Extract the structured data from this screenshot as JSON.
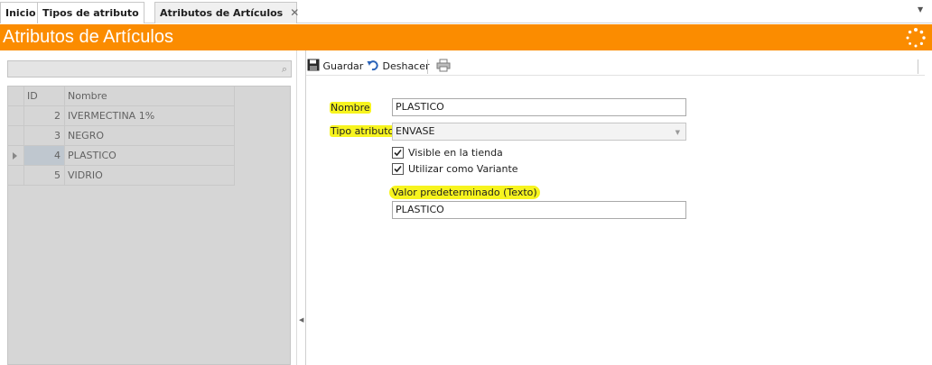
{
  "tabs": [
    {
      "label": "Inicio"
    },
    {
      "label": "Tipos de atributo"
    },
    {
      "label": "Atributos de Artículos",
      "close": "✕"
    }
  ],
  "window": {
    "title": "Atributos de Artículos"
  },
  "search": {
    "placeholder": ""
  },
  "grid": {
    "columns": [
      "ID",
      "Nombre"
    ],
    "rows": [
      {
        "id": "2",
        "nombre": "IVERMECTINA 1%"
      },
      {
        "id": "3",
        "nombre": "NEGRO"
      },
      {
        "id": "4",
        "nombre": "PLASTICO",
        "selected": true
      },
      {
        "id": "5",
        "nombre": "VIDRIO"
      }
    ]
  },
  "toolbar": {
    "save_label": "Guardar",
    "undo_label": "Deshacer",
    "print_icon": "printer-icon"
  },
  "form": {
    "nombre_label": "Nombre",
    "nombre_value": "PLASTICO",
    "tipo_label": "Tipo atributo",
    "tipo_value": "ENVASE",
    "visible_label": "Visible en la tienda",
    "visible_checked": true,
    "variante_label": "Utilizar como Variante",
    "variante_checked": true,
    "valor_label": "Valor predeterminado (Texto)",
    "valor_value": "PLASTICO"
  },
  "colors": {
    "accent": "#fb8c00",
    "highlight": "#f7f41e",
    "grid_bg": "#d6d6d6"
  }
}
